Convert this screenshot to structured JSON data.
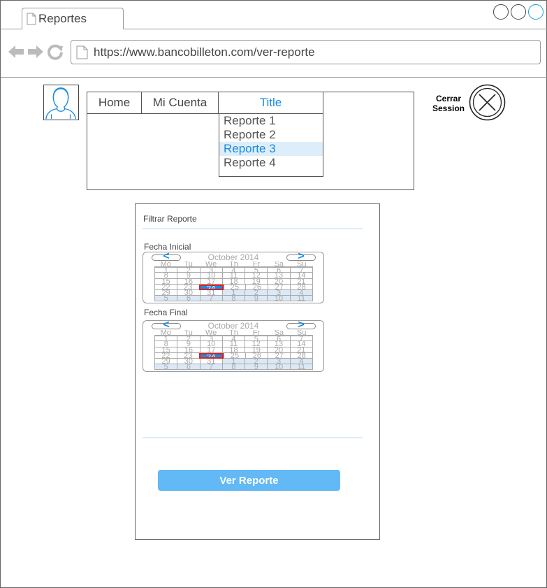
{
  "browser": {
    "tab_title": "Reportes",
    "url": "https://www.bancobilleton.com/ver-reporte"
  },
  "menu": {
    "tabs": [
      {
        "label": "Home"
      },
      {
        "label": "Mi Cuenta"
      },
      {
        "label": "Title"
      }
    ],
    "dropdown": [
      {
        "label": "Reporte 1"
      },
      {
        "label": "Reporte 2"
      },
      {
        "label": "Reporte 3",
        "selected": true
      },
      {
        "label": "Reporte 4"
      }
    ]
  },
  "logout": {
    "label_line1": "Cerrar",
    "label_line2": "Session"
  },
  "filter": {
    "title": "Filtrar Reporte",
    "start_label": "Fecha Inicial",
    "end_label": "Fecha Final",
    "button": "Ver Reporte"
  },
  "calendar": {
    "month": "October 2014",
    "prev": "<",
    "next": ">",
    "days_of_week": [
      "Mo",
      "Tu",
      "We",
      "Th",
      "Fr",
      "Sa",
      "Su"
    ],
    "weeks": [
      [
        "1",
        "2",
        "3",
        "4",
        "5",
        "6",
        "7"
      ],
      [
        "8",
        "9",
        "10",
        "11",
        "12",
        "13",
        "14"
      ],
      [
        "15",
        "16",
        "17",
        "18",
        "19",
        "20",
        "21"
      ],
      [
        "22",
        "23",
        "24",
        "25",
        "26",
        "27",
        "28"
      ],
      [
        "29",
        "30",
        "31",
        "1",
        "2",
        "3",
        "4"
      ],
      [
        "5",
        "6",
        "7",
        "8",
        "9",
        "10",
        "11"
      ]
    ],
    "selected_day": "24"
  },
  "colors": {
    "accent": "#1a8be0",
    "button": "#63b8f6",
    "highlight": "#ddeefa"
  }
}
